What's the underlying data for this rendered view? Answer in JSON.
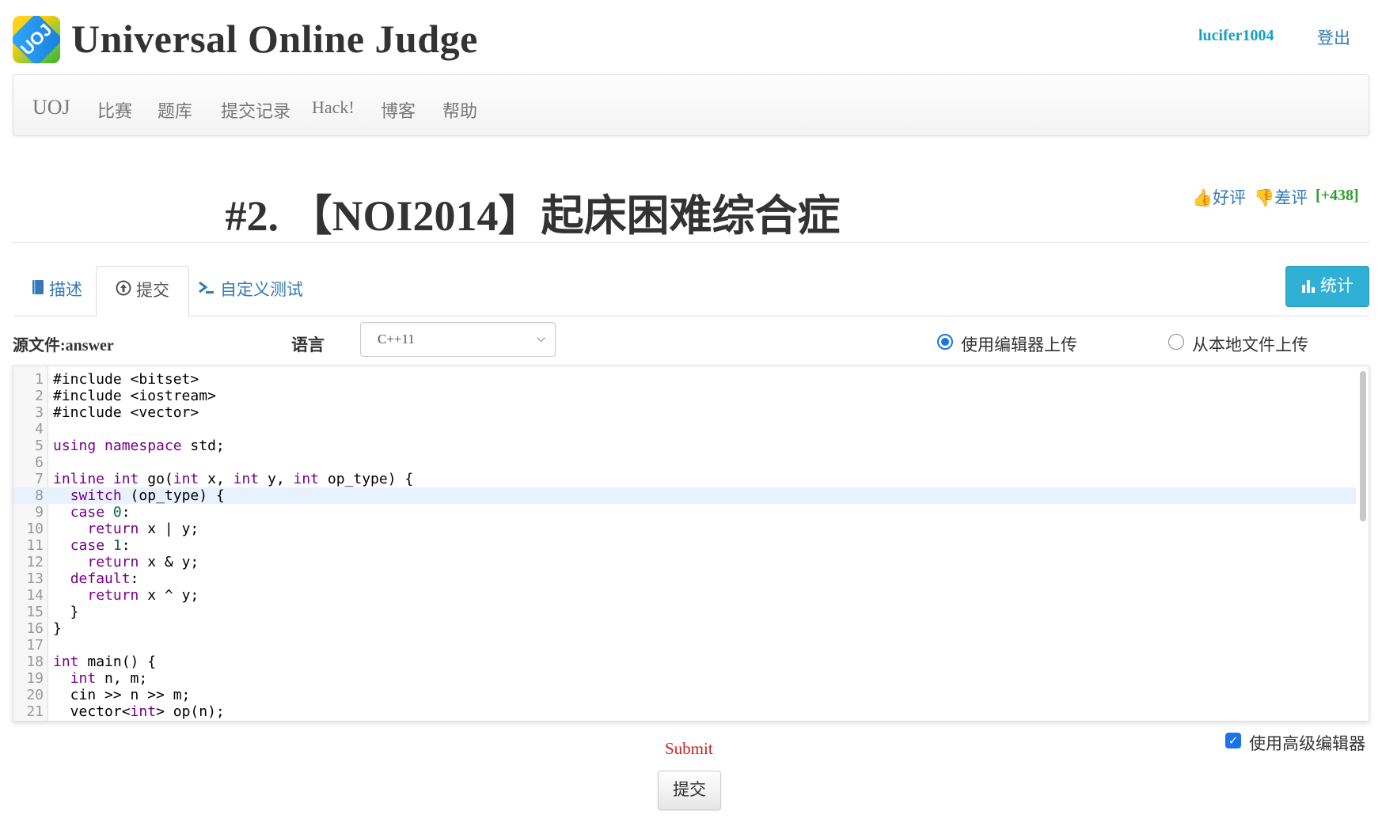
{
  "header": {
    "logo_text": "UOJ",
    "title": "Universal Online Judge",
    "username": "lucifer1004",
    "logout": "登出"
  },
  "navbar": {
    "brand": "UOJ",
    "items": [
      "比赛",
      "题库",
      "提交记录",
      "Hack!",
      "博客",
      "帮助"
    ]
  },
  "problem": {
    "title": "#2. 【NOI2014】起床困难综合症",
    "upvote": "好评",
    "downvote": "差评",
    "score": "[+438]"
  },
  "tabs": [
    {
      "label": "描述",
      "icon": "book-icon"
    },
    {
      "label": "提交",
      "icon": "upload-icon"
    },
    {
      "label": "自定义测试",
      "icon": "terminal-icon"
    }
  ],
  "stats_button": "统计",
  "form": {
    "source_label": "源文件:answer",
    "language_label": "语言",
    "language_value": "C++11",
    "radio_editor": "使用编辑器上传",
    "radio_file": "从本地文件上传",
    "advanced_editor": "使用高级编辑器",
    "submit_text": "Submit",
    "submit_button": "提交"
  },
  "code": [
    "#include <bitset>",
    "#include <iostream>",
    "#include <vector>",
    "",
    "using namespace std;",
    "",
    "inline int go(int x, int y, int op_type) {",
    "  switch (op_type) {",
    "  case 0:",
    "    return x | y;",
    "  case 1:",
    "    return x & y;",
    "  default:",
    "    return x ^ y;",
    "  }",
    "}",
    "",
    "int main() {",
    "  int n, m;",
    "  cin >> n >> m;",
    "  vector<int> op(n);"
  ],
  "active_line": 8,
  "colors": {
    "link": "#337ab7",
    "username": "#17a2b8",
    "score": "#2e9e2e",
    "stats_button": "#31b0d5",
    "submit_text": "#cc2222",
    "keyword": "#770088"
  }
}
